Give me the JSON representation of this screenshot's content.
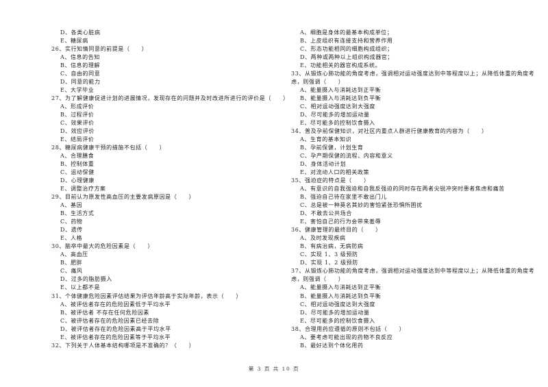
{
  "left_column": [
    {
      "type": "opt",
      "text": "D、各类心脏病"
    },
    {
      "type": "opt",
      "text": "E、糖尿病"
    },
    {
      "type": "q",
      "text": "26、实行知情同意的前提是（　　）"
    },
    {
      "type": "opt",
      "text": "A、信息的告知"
    },
    {
      "type": "opt",
      "text": "B、信息的理解"
    },
    {
      "type": "opt",
      "text": "C、自由的同意"
    },
    {
      "type": "opt",
      "text": "D、同意的能力"
    },
    {
      "type": "opt",
      "text": "E、大学毕业"
    },
    {
      "type": "q",
      "text": "27、为了解健康促进计划的进展情况，发现存在的问题并及时改进所进行的评价是（　　）"
    },
    {
      "type": "opt",
      "text": "A、形成评价"
    },
    {
      "type": "opt",
      "text": "B、过程评价"
    },
    {
      "type": "opt",
      "text": "C、效果评价"
    },
    {
      "type": "opt",
      "text": "D、效应评价"
    },
    {
      "type": "opt",
      "text": "E、结局评价"
    },
    {
      "type": "q",
      "text": "28、糖尿病健康干预的措施不包括（　　）"
    },
    {
      "type": "opt",
      "text": "A、合理膳食"
    },
    {
      "type": "opt",
      "text": "B、控制体重"
    },
    {
      "type": "opt",
      "text": "C、运动保健"
    },
    {
      "type": "opt",
      "text": "D、心理健康"
    },
    {
      "type": "opt",
      "text": "E、调整治疗方案"
    },
    {
      "type": "q",
      "text": "29、目前认为原发性高血压的主要发病原因是（　　）"
    },
    {
      "type": "opt",
      "text": "A、基因"
    },
    {
      "type": "opt",
      "text": "B、生活方式"
    },
    {
      "type": "opt",
      "text": "C、药物"
    },
    {
      "type": "opt",
      "text": "D、遗传"
    },
    {
      "type": "opt",
      "text": "E、人格"
    },
    {
      "type": "q",
      "text": "30、脑卒中最大的危险因素是（　　）"
    },
    {
      "type": "opt",
      "text": "A、高血压"
    },
    {
      "type": "opt",
      "text": "B、肥胖"
    },
    {
      "type": "opt",
      "text": "C、痛风"
    },
    {
      "type": "opt",
      "text": "D、过多的脂肪摄入"
    },
    {
      "type": "opt",
      "text": "E、以上都不是"
    },
    {
      "type": "q",
      "text": "31、个体健康危险因素评估结果为评估年龄高于实际年龄，表示（　　）"
    },
    {
      "type": "opt",
      "text": "A、被评估者存在的危险因素低于平均水平"
    },
    {
      "type": "opt",
      "text": "B、被评估者 不存在任何危险因素"
    },
    {
      "type": "opt",
      "text": "C、被评估者存在的危险因素已经去除"
    },
    {
      "type": "opt",
      "text": "D、被评估者存在的危险因素高于平均水平"
    },
    {
      "type": "opt",
      "text": "E、被评估者存在的危险因素等于平均水平"
    },
    {
      "type": "q",
      "text": "32、下列关于人体基本结构哪项是不准确的？（　　）"
    }
  ],
  "right_column": [
    {
      "type": "opt",
      "text": "A、细胞是身体的最基本构成单位；"
    },
    {
      "type": "opt",
      "text": "B、上皮组织有连接支持和营养作用"
    },
    {
      "type": "opt",
      "text": "C、形态功能相同的细胞构成组织；"
    },
    {
      "type": "opt",
      "text": "D、两种或两种以上组织构成器官；"
    },
    {
      "type": "opt",
      "text": "E、功能相关的器官构成系统。"
    },
    {
      "type": "q",
      "text": "33、从锻炼心肺功能的角度考虑，强调相对运动强度达到中等程度以上；从降低体重的角度考"
    },
    {
      "type": "q",
      "text": "虑，则强调（　　）"
    },
    {
      "type": "opt",
      "text": "A、能量摄入与消耗达到正平衡"
    },
    {
      "type": "opt",
      "text": "B、能量摄入与消耗达到负平衡"
    },
    {
      "type": "opt",
      "text": "C、相对运动强度达到大强度"
    },
    {
      "type": "opt",
      "text": "D、尽可能多的增加运动量"
    },
    {
      "type": "opt",
      "text": "E、尽可能多的控制饮食摄入"
    },
    {
      "type": "q",
      "text": "34、普及孕前保健知识，对社区内重点人群进行健康教育的内容为（　　）"
    },
    {
      "type": "opt",
      "text": "A、生育的基本知识"
    },
    {
      "type": "opt",
      "text": "B、孕前保健，计划生育"
    },
    {
      "type": "opt",
      "text": "C、孕产期保健的流程、内容和意义"
    },
    {
      "type": "opt",
      "text": "D、身体活动计划"
    },
    {
      "type": "opt",
      "text": "E、对流动人口的相关政策"
    },
    {
      "type": "q",
      "text": "35、强迫症的特点是（　　）"
    },
    {
      "type": "opt",
      "text": "A、有意识的自我强迫和自我反强迫的同时存在两者尖锐冲突时患者焦虑和痛苦"
    },
    {
      "type": "opt",
      "text": "B、强迫自己待在家里不敢出门儿"
    },
    {
      "type": "opt",
      "text": "C、总是被一种莫名其妙的害怕紧张恐惧所困扰"
    },
    {
      "type": "opt",
      "text": "D、不敢去公共场合"
    },
    {
      "type": "opt",
      "text": "E、害怕自己的行为会带来羞辱"
    },
    {
      "type": "q",
      "text": "36、健康管理的最终目的（　　）"
    },
    {
      "type": "opt",
      "text": "A、及时发现疾病"
    },
    {
      "type": "opt",
      "text": "B、有病治病，无病防病"
    },
    {
      "type": "opt",
      "text": "C、实现 1、3 级预防"
    },
    {
      "type": "opt",
      "text": "D、实现 1、2 级预防"
    },
    {
      "type": "q",
      "text": "37、从锻炼心肺功能的角度考虑，强调相对运动强度达到中等程度以上；从降低体重的角度考"
    },
    {
      "type": "q",
      "text": "虑，则强调（　　）"
    },
    {
      "type": "opt",
      "text": "A、能量摄入与消耗达到正平衡"
    },
    {
      "type": "opt",
      "text": "B、能量摄入与消耗达到负平衡"
    },
    {
      "type": "opt",
      "text": "C、相对运动强度达到大强度"
    },
    {
      "type": "opt",
      "text": "D、尽可能多的增加运动量"
    },
    {
      "type": "opt",
      "text": "E、尽可能多的控制饮食摄入"
    },
    {
      "type": "q",
      "text": "38、合理用药应遵循的原则不包括（　　）"
    },
    {
      "type": "opt",
      "text": "A、要考虑可能出现的药物不良反应"
    },
    {
      "type": "opt",
      "text": "B、最好达到个体化用药"
    }
  ],
  "footer": {
    "page_label": "第 3 页 共 10 页"
  }
}
